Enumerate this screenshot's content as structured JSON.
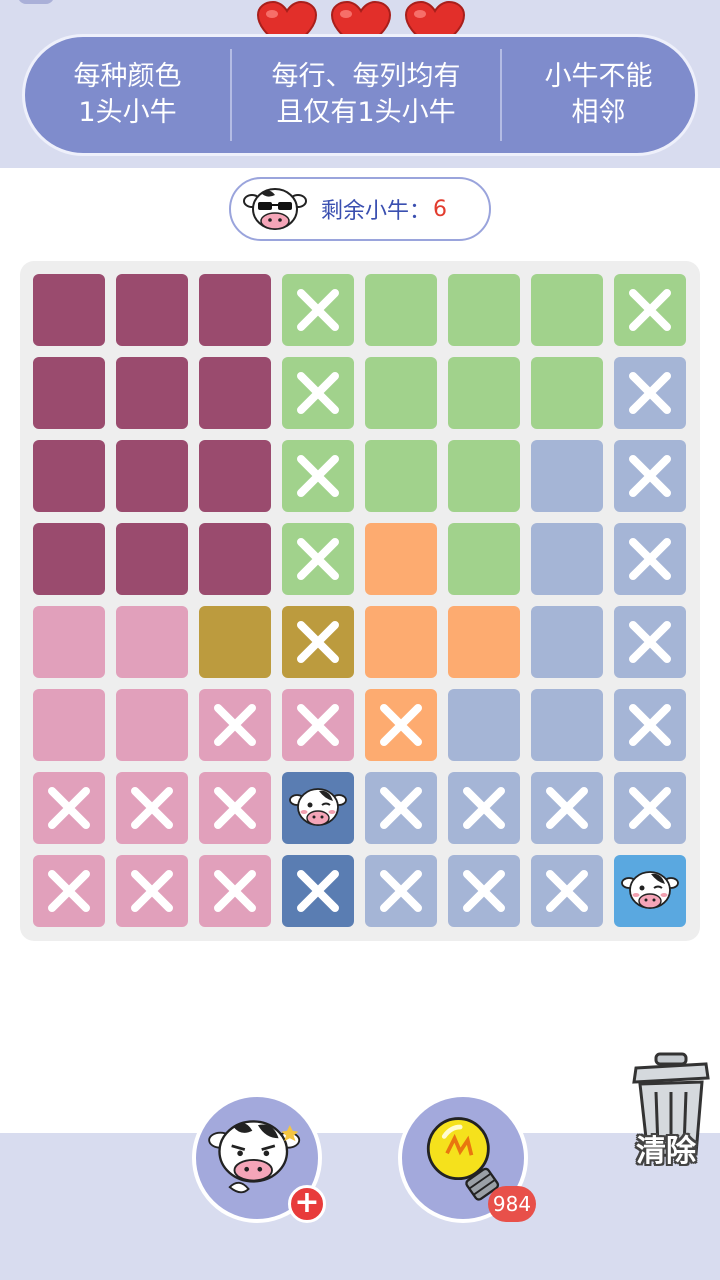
{
  "lives": {
    "count": 3,
    "icon": "heart-icon",
    "color": "#e22f2a"
  },
  "rules": [
    {
      "line1": "每种颜色",
      "line2": "1头小牛"
    },
    {
      "line1": "每行、每列均有",
      "line2": "且仅有1头小牛"
    },
    {
      "line1": "小牛不能",
      "line2": "相邻"
    }
  ],
  "remaining": {
    "label": "剩余小牛：",
    "count": "6"
  },
  "colors": {
    "P": "#9a4b6e",
    "G": "#a1d28c",
    "L": "#a5b5d6",
    "O": "#fdab70",
    "K": "#e1a0bb",
    "Y": "#bc9b3e",
    "D": "#5a7db2",
    "S": "#5aa8e0"
  },
  "board": {
    "size": 8,
    "rows": [
      [
        "P",
        "P",
        "P",
        "G",
        "G",
        "G",
        "G",
        "G"
      ],
      [
        "P",
        "P",
        "P",
        "G",
        "G",
        "G",
        "G",
        "L"
      ],
      [
        "P",
        "P",
        "P",
        "G",
        "G",
        "G",
        "L",
        "L"
      ],
      [
        "P",
        "P",
        "P",
        "G",
        "O",
        "G",
        "L",
        "L"
      ],
      [
        "K",
        "K",
        "Y",
        "Y",
        "O",
        "O",
        "L",
        "L"
      ],
      [
        "K",
        "K",
        "K",
        "K",
        "O",
        "L",
        "L",
        "L"
      ],
      [
        "K",
        "K",
        "K",
        "D",
        "L",
        "L",
        "L",
        "L"
      ],
      [
        "K",
        "K",
        "K",
        "D",
        "L",
        "L",
        "L",
        "S"
      ]
    ],
    "marks": [
      [
        ".",
        ".",
        ".",
        "x",
        ".",
        ".",
        ".",
        "x"
      ],
      [
        ".",
        ".",
        ".",
        "x",
        ".",
        ".",
        ".",
        "x"
      ],
      [
        ".",
        ".",
        ".",
        "x",
        ".",
        ".",
        ".",
        "x"
      ],
      [
        ".",
        ".",
        ".",
        "x",
        ".",
        ".",
        ".",
        "x"
      ],
      [
        ".",
        ".",
        ".",
        "x",
        ".",
        ".",
        ".",
        "x"
      ],
      [
        ".",
        ".",
        "x",
        "x",
        "x",
        ".",
        ".",
        "x"
      ],
      [
        "x",
        "x",
        "x",
        "c",
        "x",
        "x",
        "x",
        "x"
      ],
      [
        "x",
        "x",
        "x",
        "x",
        "x",
        "x",
        "x",
        "c"
      ]
    ]
  },
  "buttons": {
    "cow_helper": {
      "icon": "cow-thinking-icon",
      "badge": "+"
    },
    "hint": {
      "icon": "light-bulb-icon",
      "count": "984"
    },
    "clear": {
      "icon": "trash-can-icon",
      "label": "清除"
    }
  }
}
